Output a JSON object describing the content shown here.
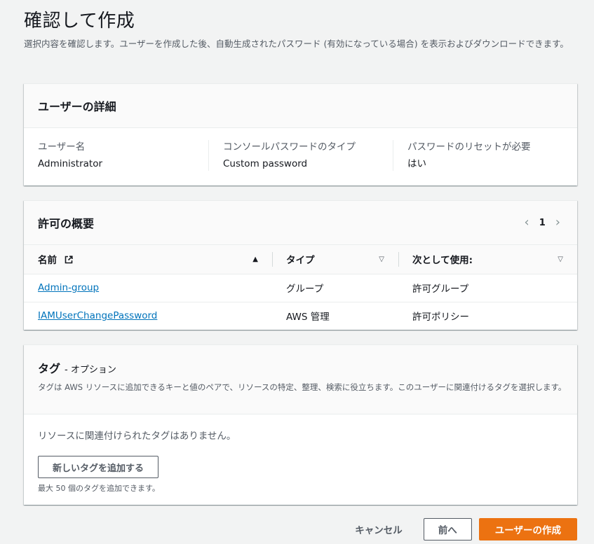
{
  "page": {
    "title": "確認して作成",
    "description": "選択内容を確認します。ユーザーを作成した後、自動生成されたパスワード (有効になっている場合) を表示およびダウンロードできます。"
  },
  "user_details": {
    "title": "ユーザーの詳細",
    "fields": [
      {
        "label": "ユーザー名",
        "value": "Administrator"
      },
      {
        "label": "コンソールパスワードのタイプ",
        "value": "Custom password"
      },
      {
        "label": "パスワードのリセットが必要",
        "value": "はい"
      }
    ]
  },
  "permissions": {
    "title": "許可の概要",
    "page": "1",
    "columns": [
      "名前",
      "タイプ",
      "次として使用:"
    ],
    "rows": [
      {
        "name": "Admin-group",
        "type": "グループ",
        "used_as": "許可グループ"
      },
      {
        "name": "IAMUserChangePassword",
        "type": "AWS 管理",
        "used_as": "許可ポリシー"
      }
    ]
  },
  "tags": {
    "title": "タグ",
    "optional": "- オプション",
    "description": "タグは AWS リソースに追加できるキーと値のペアで、リソースの特定、整理、検索に役立ちます。このユーザーに関連付けるタグを選択します。",
    "empty_message": "リソースに関連付けられたタグはありません。",
    "add_button": "新しいタグを追加する",
    "hint": "最大 50 個のタグを追加できます。"
  },
  "footer": {
    "cancel": "キャンセル",
    "previous": "前へ",
    "create": "ユーザーの作成"
  },
  "colors": {
    "primary": "#ec7211",
    "link": "#0073bb",
    "background": "#f2f3f3"
  }
}
